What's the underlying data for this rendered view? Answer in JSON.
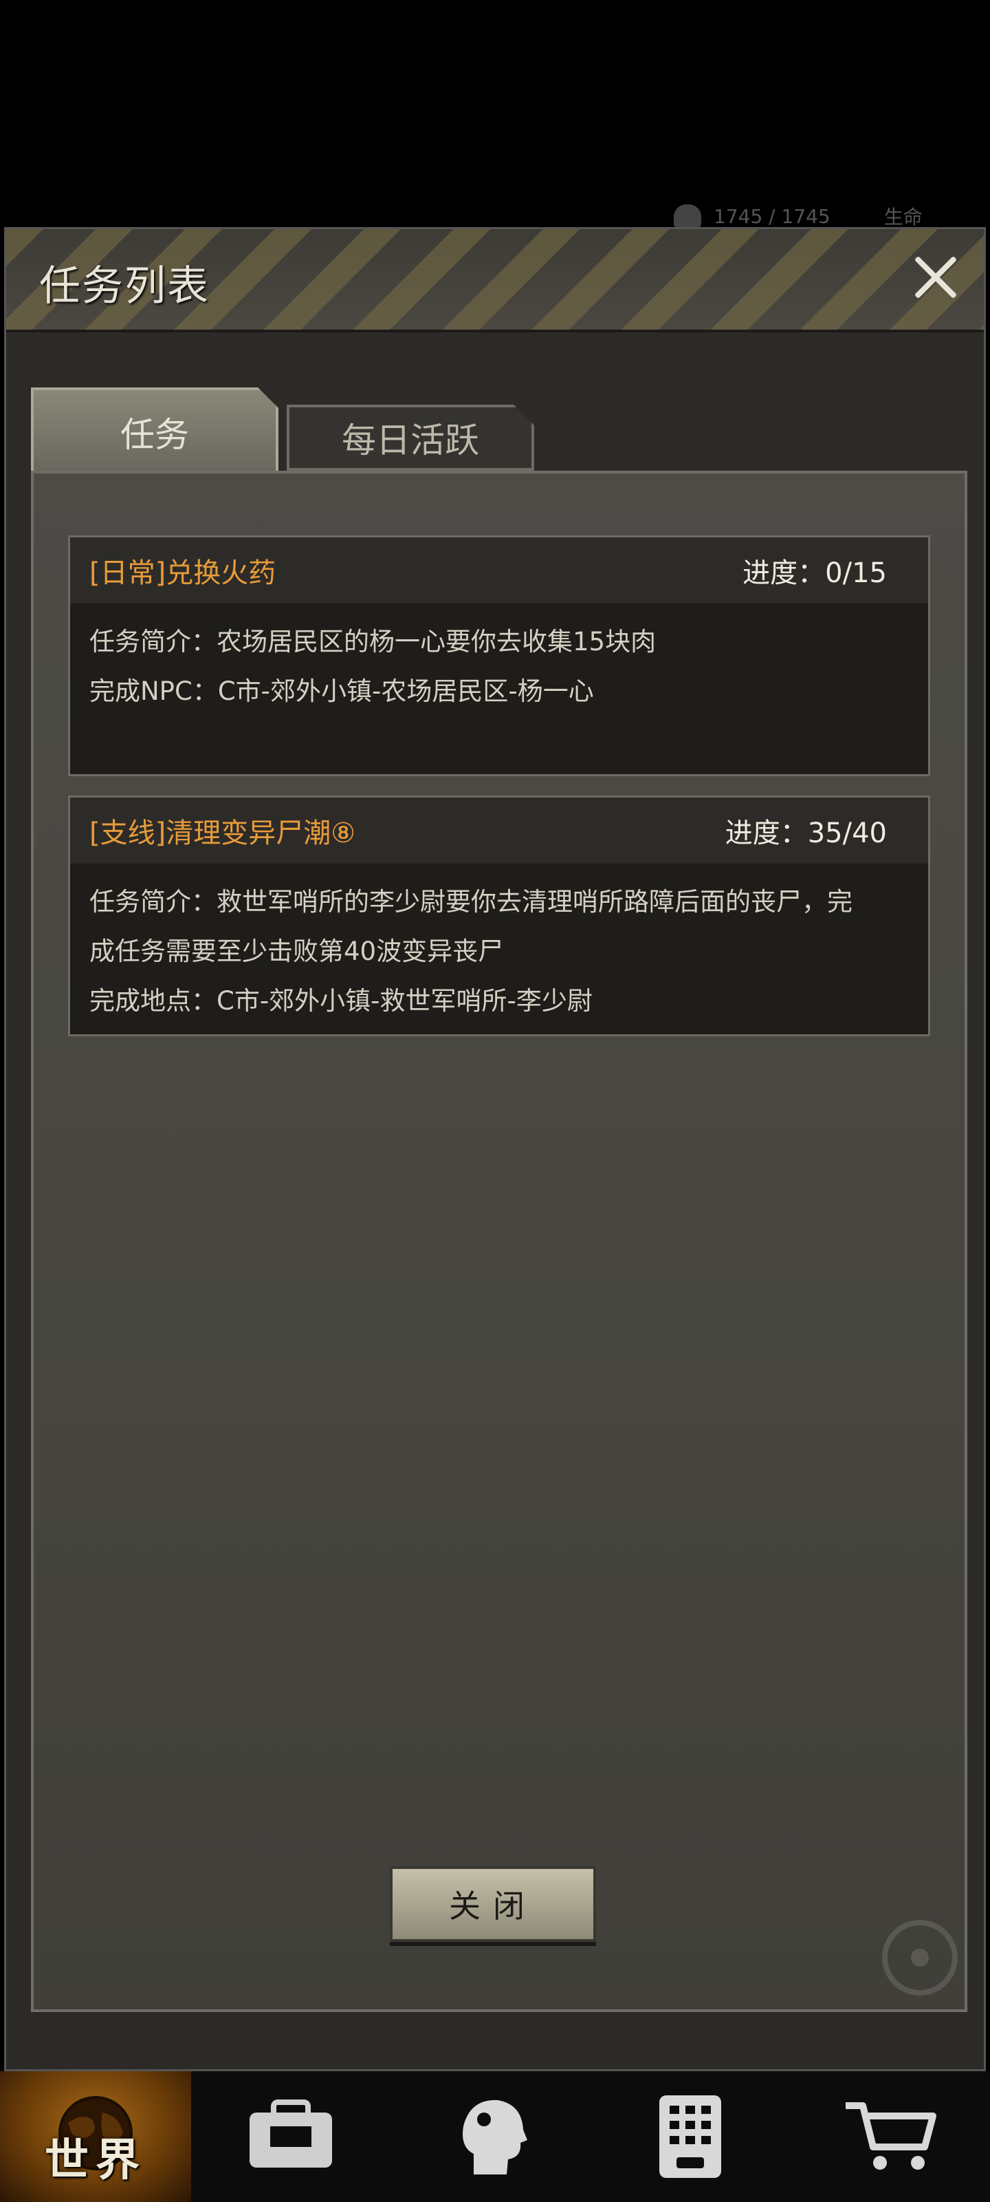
{
  "background": {
    "status_text": "1745 / 1745",
    "status_label": "生命"
  },
  "modal": {
    "title": "任务列表"
  },
  "tabs": [
    {
      "label": "任务",
      "active": true
    },
    {
      "label": "每日活跃",
      "active": false
    }
  ],
  "quests": [
    {
      "title": "[日常]兑换火药",
      "progress": "进度：0/15",
      "lines": [
        "任务简介：农场居民区的杨一心要你去收集15块肉",
        "完成NPC：C市-郊外小镇-农场居民区-杨一心"
      ]
    },
    {
      "title": "[支线]清理变异尸潮⑧",
      "progress": "进度：35/40",
      "lines": [
        "任务简介：救世军哨所的李少尉要你去清理哨所路障后面的丧尸，完",
        "成任务需要至少击败第40波变异丧尸",
        "完成地点：C市-郊外小镇-救世军哨所-李少尉"
      ]
    }
  ],
  "close_button": {
    "label": "关闭"
  },
  "bottom_nav": {
    "items": [
      {
        "label": "世界",
        "icon": "globe-icon",
        "active": true
      },
      {
        "label": "",
        "icon": "backpack-icon",
        "active": false
      },
      {
        "label": "",
        "icon": "head-icon",
        "active": false
      },
      {
        "label": "",
        "icon": "phone-icon",
        "active": false
      },
      {
        "label": "",
        "icon": "cart-icon",
        "active": false
      }
    ]
  },
  "colors": {
    "quest_title": "#e89b3a",
    "panel_bg": "#4c4b46",
    "card_bg": "#1e1d1a"
  }
}
